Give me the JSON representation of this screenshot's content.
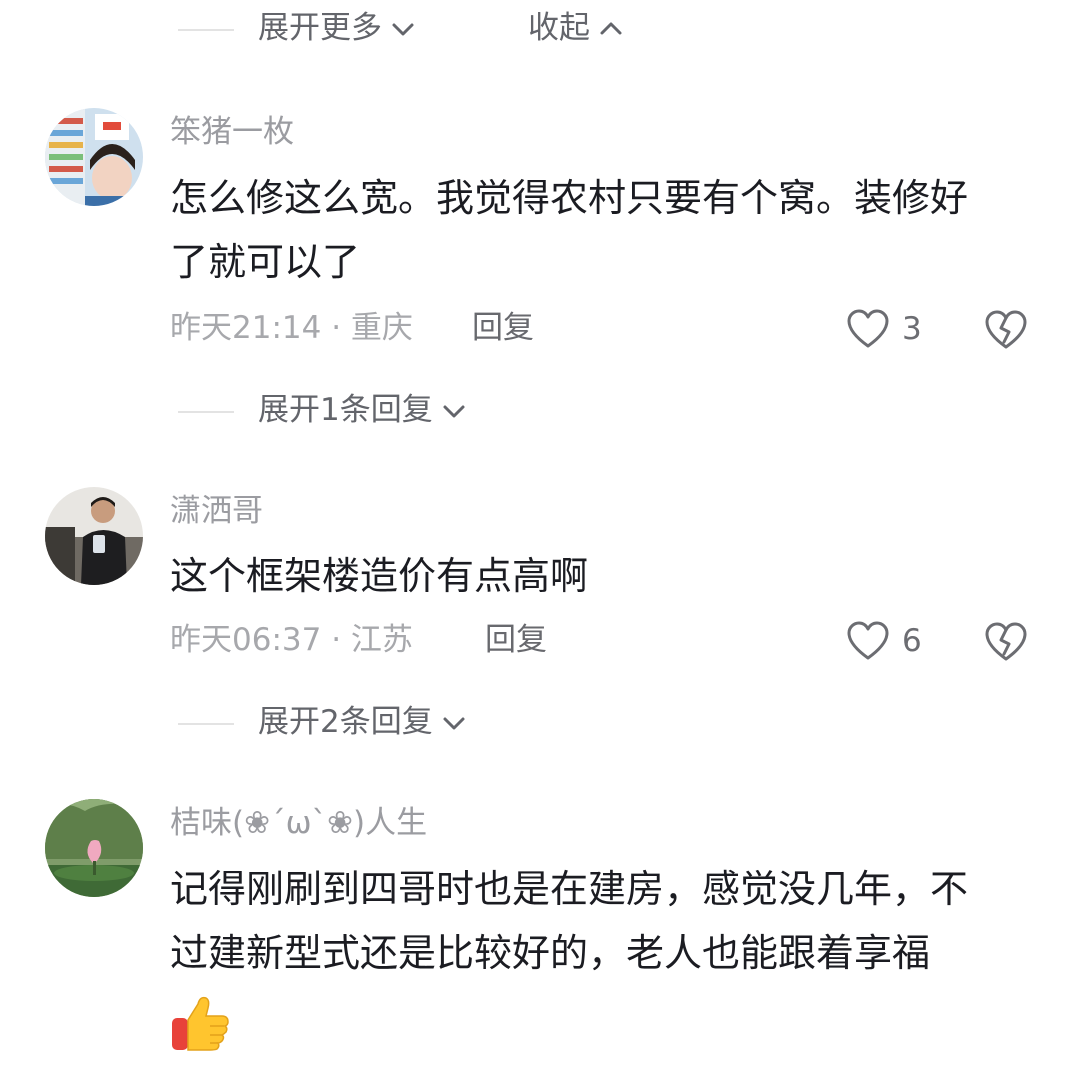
{
  "top_bar": {
    "expand_more_label": "展开更多",
    "collapse_label": "收起"
  },
  "comments": [
    {
      "username": "笨猪一枚",
      "text_line1": "怎么修这么宽。我觉得农村只要有个窝。装修好",
      "text_line2": "了就可以了",
      "time_location": "昨天21:14 · 重庆",
      "reply_label": "回复",
      "likes": "3",
      "expand_replies_label": "展开1条回复"
    },
    {
      "username": "潇洒哥",
      "text_line1": "这个框架楼造价有点高啊",
      "time_location": "昨天06:37 · 江苏",
      "reply_label": "回复",
      "likes": "6",
      "expand_replies_label": "展开2条回复"
    },
    {
      "username": "桔味(❀´ω`❀)人生",
      "text_line1": "记得刚刷到四哥时也是在建房，感觉没几年，不",
      "text_line2": "过建新型式还是比较好的，老人也能跟着享福",
      "emoji": "thumbs-up"
    }
  ],
  "colors": {
    "muted_text": "#9b9ca1",
    "body_text": "#1b1c22",
    "divider": "#e3e3e3"
  }
}
